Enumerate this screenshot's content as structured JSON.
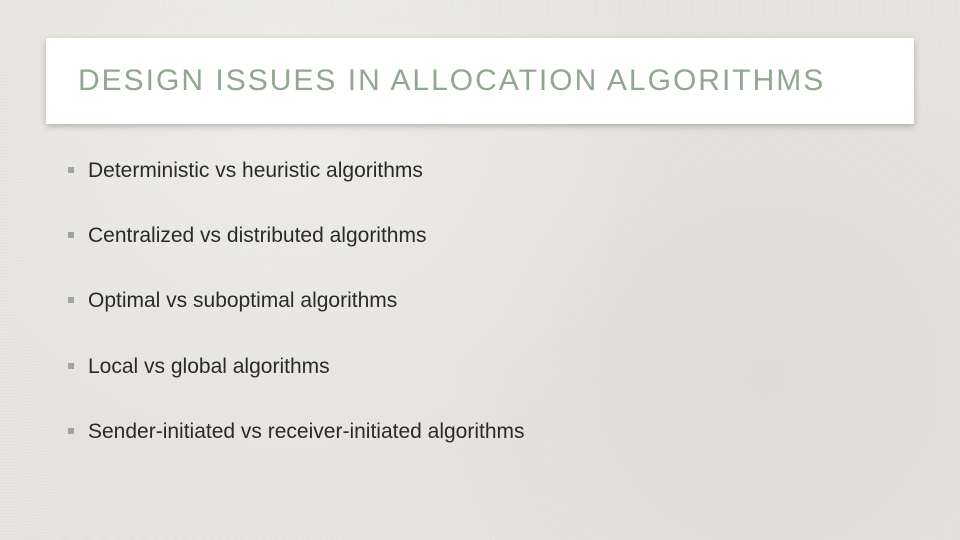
{
  "title": "DESIGN ISSUES IN ALLOCATION ALGORITHMS",
  "bullets": [
    "Deterministic vs heuristic algorithms",
    "Centralized vs distributed algorithms",
    "Optimal vs suboptimal algorithms",
    "Local vs global algorithms",
    "Sender-initiated vs receiver-initiated algorithms"
  ],
  "colors": {
    "title_color": "#8fa88f",
    "background": "#e6e4dd",
    "bullet_text": "#2a2a2a",
    "bullet_dot": "#a0a49a"
  }
}
